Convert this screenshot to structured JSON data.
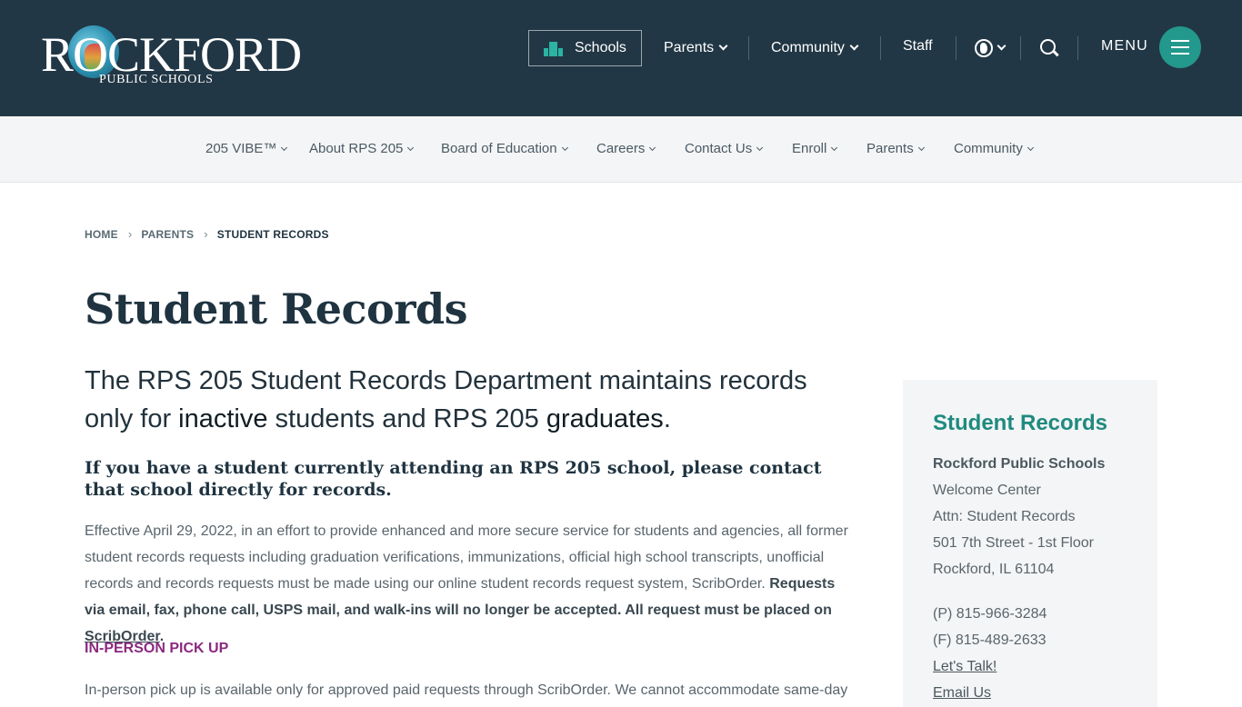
{
  "header": {
    "logo_big": "ROCKFORD",
    "logo_small": "PUBLIC SCHOOLS",
    "schools_label": "Schools",
    "nav": [
      {
        "label": "Parents"
      },
      {
        "label": "Community"
      },
      {
        "label": "Staff"
      }
    ],
    "menu_label": "MENU",
    "accent_color": "#23988c",
    "bg_color": "#223745"
  },
  "subnav": {
    "items": [
      "205 VIBE™",
      "About RPS 205",
      "Board of Education",
      "Careers",
      "Contact Us",
      "Enroll",
      "Parents",
      "Community"
    ]
  },
  "breadcrumb": {
    "home": "HOME",
    "parent": "PARENTS",
    "current": "STUDENT RECORDS"
  },
  "main": {
    "title": "Student Records",
    "intro_1": "The RPS 205 Student Records Department maintains records only for ",
    "intro_em1": "inactive",
    "intro_2": " students and RPS 205 ",
    "intro_em2": "graduates",
    "intro_3": ".",
    "alert": "If you have a student currently attending an RPS 205 school, please contact that school directly for records.",
    "para_text": "Effective April 29, 2022, in an effort to provide enhanced and more secure service for students and agencies, all former student records requests including graduation verifications, immunizations, official high school transcripts, unofficial records and records requests must be made using our online student records request system, ScribOrder. ",
    "para_bold": "Requests via email, fax, phone call, USPS mail, and walk-ins will no longer be accepted. All request must be placed on ",
    "para_link": "ScribOrder",
    "para_end": ".",
    "pickup_heading": "IN-PERSON PICK UP",
    "pickup_text": "In-person pick up is available only for approved paid requests through ScribOrder. We cannot accommodate same-day"
  },
  "sidebar": {
    "title": "Student Records",
    "org": "Rockford Public Schools",
    "line1": "Welcome Center",
    "line2": "Attn: Student Records",
    "line3": "501 7th Street - 1st Floor",
    "line4": "Rockford, IL 61104",
    "phone": "(P) 815-966-3284",
    "fax": "(F) 815-489-2633",
    "talk_link": "Let's Talk!",
    "email_link": "Email Us"
  }
}
